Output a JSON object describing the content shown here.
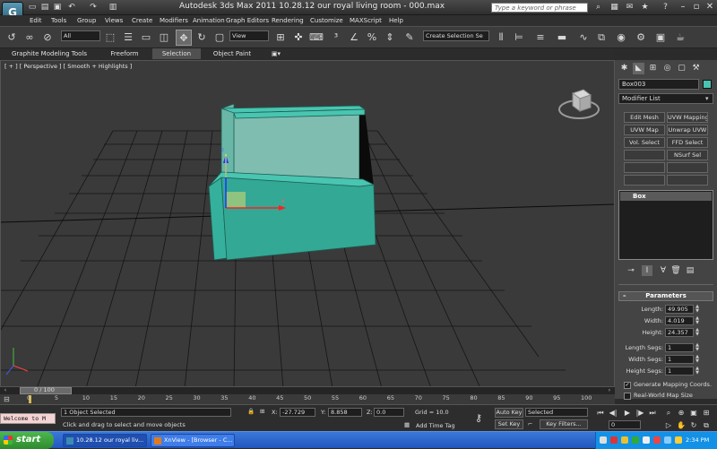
{
  "window": {
    "title": "Autodesk 3ds Max  2011      10.28.12 our royal living room - 000.max",
    "search_placeholder": "Type a keyword or phrase"
  },
  "menu": [
    "Edit",
    "Tools",
    "Group",
    "Views",
    "Create",
    "Modifiers",
    "Animation",
    "Graph Editors",
    "Rendering",
    "Customize",
    "MAXScript",
    "Help"
  ],
  "toolbar": {
    "filter": "All",
    "ref_coord": "View",
    "selection_set": "Create Selection Se"
  },
  "ribbon": {
    "tabs": [
      "Graphite Modeling Tools",
      "Freeform",
      "Selection",
      "Object Paint"
    ]
  },
  "viewport": {
    "label": "[ + ] [ Perspective ] [ Smooth + Highlights ]"
  },
  "command_panel": {
    "object_name": "Box003",
    "object_color": "#49c5b1",
    "modifier_list": "Modifier List",
    "modifier_buttons": [
      "Edit Mesh",
      "UVW Mapping Ac",
      "UVW Map",
      "Unwrap UVW",
      "Vol. Select",
      "FFD Select",
      "",
      "NSurf Sel"
    ],
    "stack_item": "Box",
    "parameters_title": "Parameters",
    "params": [
      {
        "label": "Length:",
        "value": "49.905"
      },
      {
        "label": "Width:",
        "value": "4.019"
      },
      {
        "label": "Height:",
        "value": "24.357"
      },
      {
        "label": "Length Segs:",
        "value": "1"
      },
      {
        "label": "Width Segs:",
        "value": "1"
      },
      {
        "label": "Height Segs:",
        "value": "1"
      }
    ],
    "gen_mapping": "Generate Mapping Coords.",
    "real_world": "Real-World Map Size"
  },
  "timeline": {
    "time": "0 / 100",
    "ticks": [
      "0",
      "5",
      "10",
      "15",
      "20",
      "25",
      "30",
      "35",
      "40",
      "45",
      "50",
      "55",
      "60",
      "65",
      "70",
      "75",
      "80",
      "85",
      "90",
      "95",
      "100"
    ]
  },
  "status": {
    "maxscript": "Welcome to M",
    "selected": "1 Object Selected",
    "prompt": "Click and drag to select and move objects",
    "x": "-27.729",
    "y": "8.858",
    "z": "0.0",
    "grid": "Grid = 10.0",
    "add_time_tag": "Add Time Tag",
    "auto_key": "Auto Key",
    "set_key": "Set Key",
    "key_mode": "Selected",
    "key_filters": "Key Filters...",
    "frame": "0"
  },
  "taskbar": {
    "start": "start",
    "tasks": [
      "10.28.12 our royal liv...",
      "XnView - [Browser - C..."
    ],
    "clock": "2:34 PM"
  }
}
